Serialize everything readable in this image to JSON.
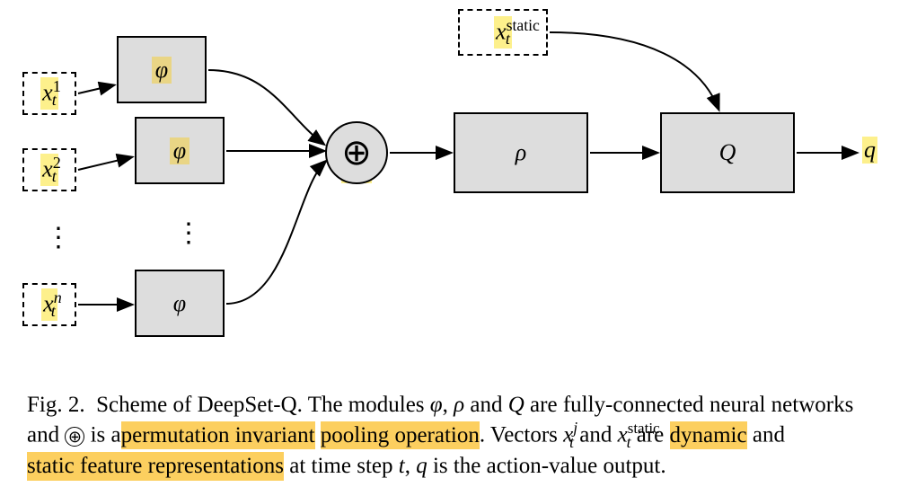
{
  "diagram": {
    "inputs": {
      "x1": "x",
      "x2": "x",
      "xn": "x",
      "xstatic": "x",
      "sub_t": "t",
      "sup_1": "1",
      "sup_2": "2",
      "sup_n": "n",
      "sup_static": "static"
    },
    "phi": "φ",
    "oplus": "⊕",
    "rho": "ρ",
    "Q": "Q",
    "q_out": "q",
    "vdots": "⋮"
  },
  "caption": {
    "fig_label": "Fig. 2.",
    "line1_a": "Scheme of DeepSet-Q. The modules ",
    "phi": "φ",
    "comma1": ", ",
    "rho": "ρ",
    "and1": " and ",
    "Q": "Q",
    "line1_b": " are fully-connected",
    "line2_a": "neural networks and ",
    "oplus": "⊕",
    "line2_b_pre": " is a",
    "line2_b_hl1": " permutation invariant",
    "line2_b_mid": " ",
    "line2_b_hl2": "pooling operation",
    "line2_c": ". Vectors",
    "xj_x": "x",
    "xj_sup": "j",
    "xj_sub": "t",
    "and2": " and ",
    "xstatic_x": "x",
    "xstatic_sup": "static",
    "xstatic_sub": "t",
    "are": " are ",
    "dynamic": "dynamic",
    "and3": " and ",
    "static_feat": "static feature representations",
    "at_time": " at time step ",
    "t_var": "t",
    "comma2": ",",
    "q_var": "q",
    "is_the": " is the action-value output."
  },
  "chart_data": {
    "type": "diagram",
    "title": "Scheme of DeepSet-Q",
    "nodes": [
      {
        "id": "x1",
        "label": "x_t^1",
        "kind": "input"
      },
      {
        "id": "x2",
        "label": "x_t^2",
        "kind": "input"
      },
      {
        "id": "xn",
        "label": "x_t^n",
        "kind": "input"
      },
      {
        "id": "xstatic",
        "label": "x_t^static",
        "kind": "input"
      },
      {
        "id": "phi1",
        "label": "φ",
        "kind": "module"
      },
      {
        "id": "phi2",
        "label": "φ",
        "kind": "module"
      },
      {
        "id": "phin",
        "label": "φ",
        "kind": "module"
      },
      {
        "id": "pool",
        "label": "⊕",
        "kind": "pooling"
      },
      {
        "id": "rho",
        "label": "ρ",
        "kind": "module"
      },
      {
        "id": "Q",
        "label": "Q",
        "kind": "module"
      },
      {
        "id": "q",
        "label": "q",
        "kind": "output"
      }
    ],
    "edges": [
      {
        "from": "x1",
        "to": "phi1"
      },
      {
        "from": "x2",
        "to": "phi2"
      },
      {
        "from": "xn",
        "to": "phin"
      },
      {
        "from": "phi1",
        "to": "pool"
      },
      {
        "from": "phi2",
        "to": "pool"
      },
      {
        "from": "phin",
        "to": "pool"
      },
      {
        "from": "pool",
        "to": "rho"
      },
      {
        "from": "rho",
        "to": "Q"
      },
      {
        "from": "xstatic",
        "to": "Q"
      },
      {
        "from": "Q",
        "to": "q"
      }
    ]
  }
}
